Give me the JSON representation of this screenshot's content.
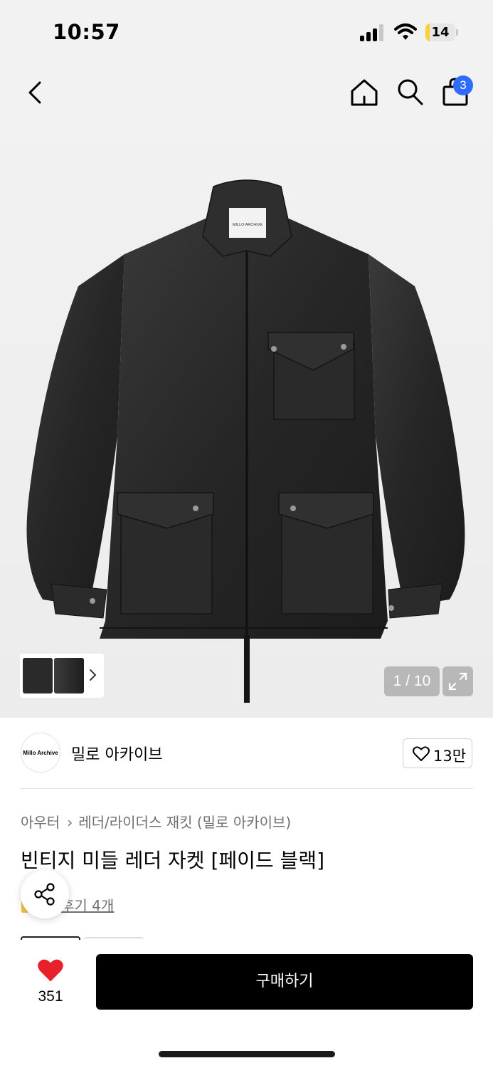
{
  "status_bar": {
    "time": "10:57",
    "battery_level": "14",
    "battery_fraction": 0.14,
    "battery_color": "#f6d23a",
    "icons": [
      "signal-icon",
      "wifi-icon",
      "battery-icon"
    ]
  },
  "header": {
    "icons": [
      "back-icon",
      "home-icon",
      "search-icon",
      "cart-icon"
    ],
    "cart_badge": "3",
    "badge_color": "#2f6bff"
  },
  "gallery": {
    "image_counter": "1 / 10",
    "label_text": "MILLO ARCHIVE",
    "icons": [
      "chevron-right-icon",
      "expand-icon"
    ]
  },
  "brand": {
    "logo_text": "Millo Archive",
    "name": "밀로 아카이브",
    "like_count": "13만"
  },
  "product": {
    "breadcrumb": [
      "아우터",
      "레더/라이더스 재킷 (밀로 아카이브)"
    ],
    "title": "빈티지 미들 레더 자켓 [페이드 블랙]",
    "review_link": "후기 4개"
  },
  "bottom_bar": {
    "wish_count": "351",
    "heart_color": "#e8202a",
    "buy_label": "구매하기"
  }
}
